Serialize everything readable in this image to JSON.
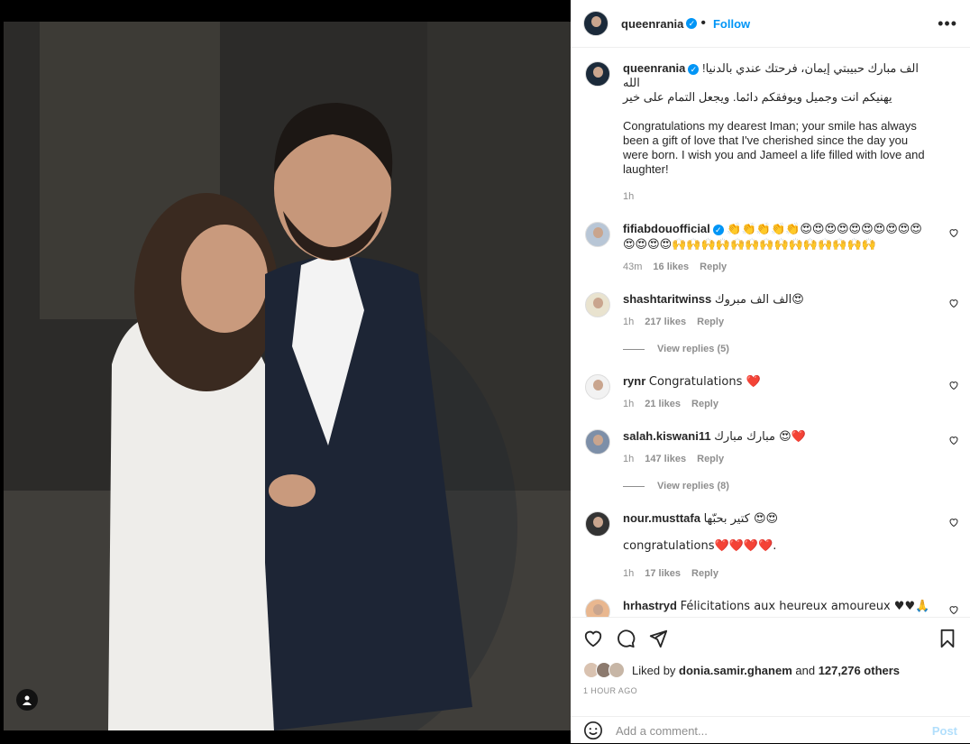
{
  "post": {
    "username": "queenrania",
    "follow_label": "Follow",
    "caption_ar_1": "الف مبارك حبيبتي إيمان، فرحتك عندي بالدنيا! الله",
    "caption_ar_2": "يهنيكم انت وجميل ويوفقكم دائما. ويجعل التمام على خير",
    "caption_en": "Congratulations my dearest Iman; your smile has always been a gift of love that I've cherished since the day you were born. I wish you and Jameel a life filled with love and laughter!",
    "caption_time": "1h"
  },
  "comments": [
    {
      "user": "fifiabdouofficial",
      "text": "👏👏👏👏👏😍😍😍😍😍😍😍😍😍😍😍😍😍😍🙌🙌🙌🙌🙌🙌🙌🙌🙌🙌🙌🙌🙌🙌",
      "time": "43m",
      "likes": "16 likes",
      "reply": "Reply"
    },
    {
      "user": "shashtaritwinss",
      "text": "الف الف مبروك😍",
      "time": "1h",
      "likes": "217 likes",
      "reply": "Reply",
      "view_replies": "View replies (5)"
    },
    {
      "user": "rynr",
      "text": "Congratulations ❤️",
      "time": "1h",
      "likes": "21 likes",
      "reply": "Reply"
    },
    {
      "user": "salah.kiswani11",
      "text": "مبارك مبارك 😍❤️",
      "time": "1h",
      "likes": "147 likes",
      "reply": "Reply",
      "view_replies": "View replies (8)"
    },
    {
      "user": "nour.musttafa",
      "text": "كتير بحبّها 😍😍",
      "text2": "congratulations❤️❤️❤️❤️.",
      "time": "1h",
      "likes": "17 likes",
      "reply": "Reply"
    },
    {
      "user": "hrhastryd",
      "text": "Félicitations aux heureux amoureux ♥♥🙏"
    }
  ],
  "likes": {
    "prefix": "Liked by",
    "user": "donia.samir.ghanem",
    "middle": "and",
    "count": "127,276 others"
  },
  "posted_ago": "1 HOUR AGO",
  "add_comment": {
    "placeholder": "Add a comment...",
    "post_label": "Post"
  },
  "colors": {
    "accent": "#0095f6",
    "muted": "#8e8e8e",
    "post_disabled": "#b2dffc"
  }
}
